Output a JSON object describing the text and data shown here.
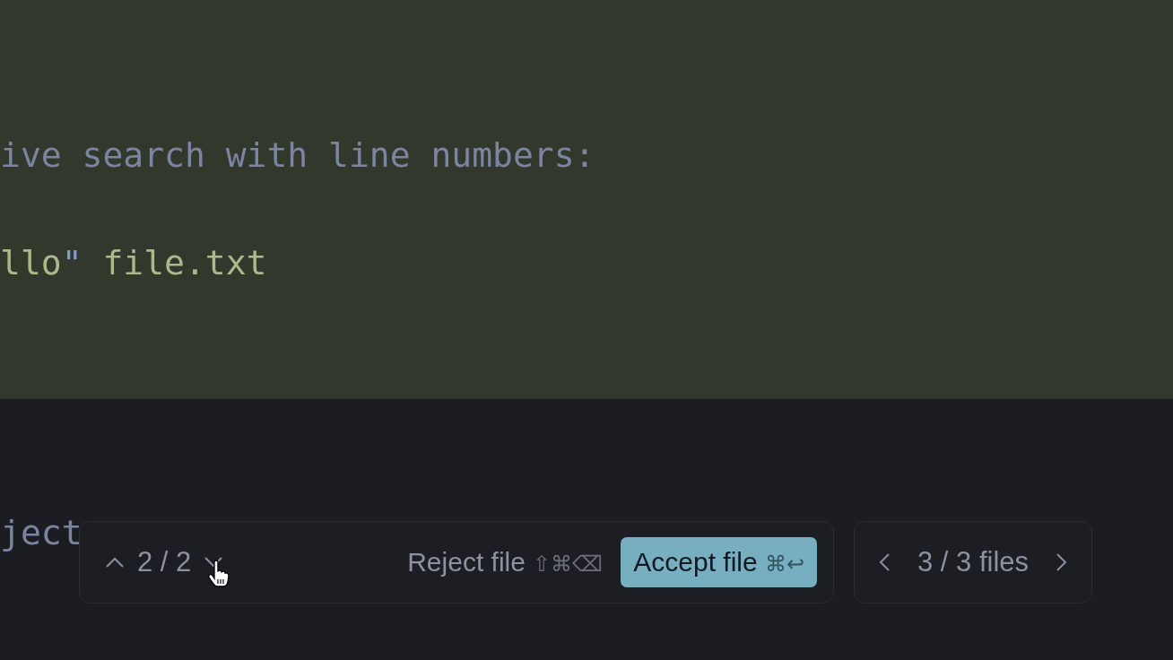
{
  "editor": {
    "lines": [
      {
        "segments": [
          {
            "text": "ive search with line numbers:",
            "kind": "comment"
          }
        ]
      },
      {
        "segments": [
          {
            "text": "llo",
            "kind": "string"
          },
          {
            "text": "\"",
            "kind": "quote"
          },
          {
            "text": " file.txt",
            "kind": "string"
          }
        ]
      }
    ]
  },
  "lower_text": "ject",
  "hunk_bar": {
    "counter": "2 / 2",
    "reject": {
      "label": "Reject file",
      "shortcut": "⇧⌘⌫"
    },
    "accept": {
      "label": "Accept file",
      "shortcut": "⌘↩"
    }
  },
  "file_bar": {
    "counter": "3 / 3 files"
  }
}
